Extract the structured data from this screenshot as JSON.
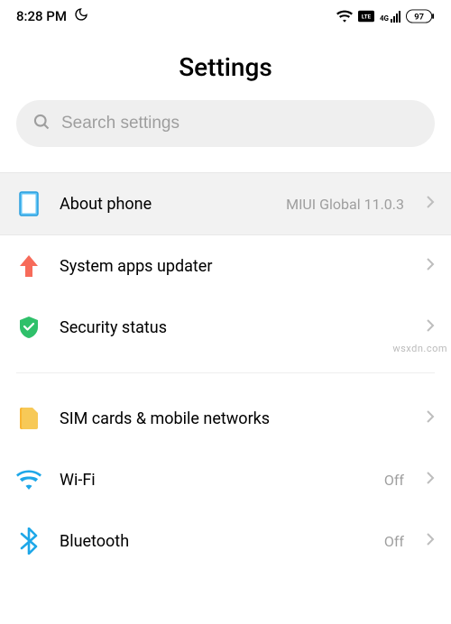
{
  "status": {
    "time": "8:28 PM",
    "network_label": "4G",
    "battery_percent": "97"
  },
  "page_title": "Settings",
  "search": {
    "placeholder": "Search settings"
  },
  "rows": {
    "about_phone": {
      "label": "About phone",
      "value": "MIUI Global 11.0.3"
    },
    "system_apps_updater": {
      "label": "System apps updater"
    },
    "security_status": {
      "label": "Security status"
    },
    "sim_networks": {
      "label": "SIM cards & mobile networks"
    },
    "wifi": {
      "label": "Wi-Fi",
      "value": "Off"
    },
    "bluetooth": {
      "label": "Bluetooth",
      "value": "Off"
    }
  },
  "watermark": "wsxdn.com"
}
